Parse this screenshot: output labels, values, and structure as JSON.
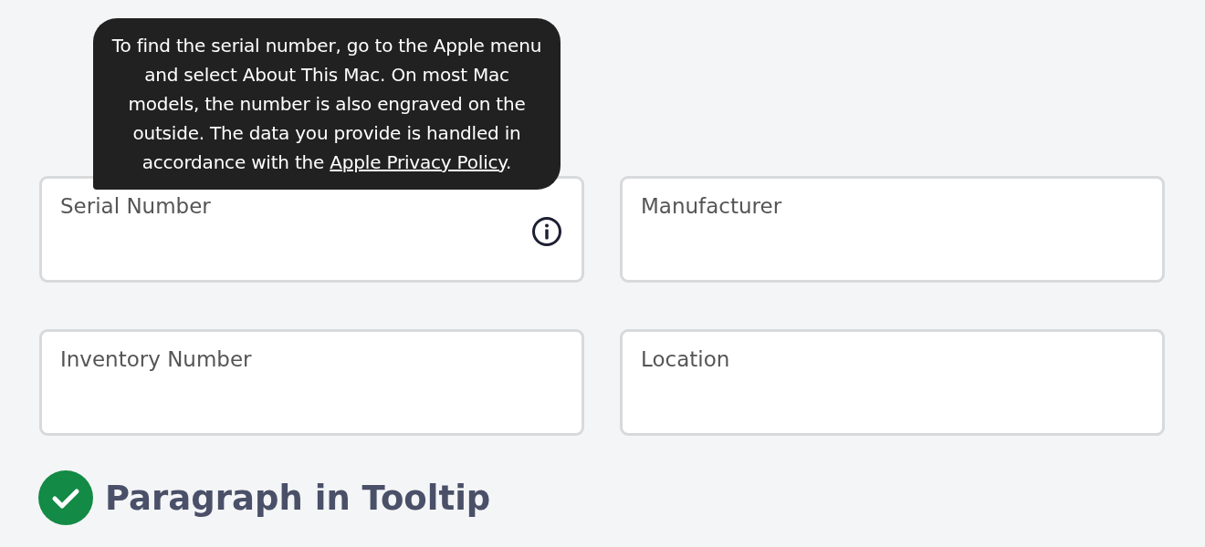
{
  "tooltip": {
    "text": "To find the serial number, go to the Apple menu and select About This Mac. On most Mac models, the number is also engraved on the outside. The data you provide is handled in accordance with the ",
    "link": "Apple Privacy Policy",
    "text_end": "."
  },
  "fields": [
    {
      "label": "Serial Number",
      "info": true
    },
    {
      "label": "Manufacturer",
      "info": false
    },
    {
      "label": "Inventory Number",
      "info": false
    },
    {
      "label": "Location",
      "info": false
    }
  ],
  "heading": {
    "text": "Paragraph in Tooltip",
    "checked": true
  }
}
